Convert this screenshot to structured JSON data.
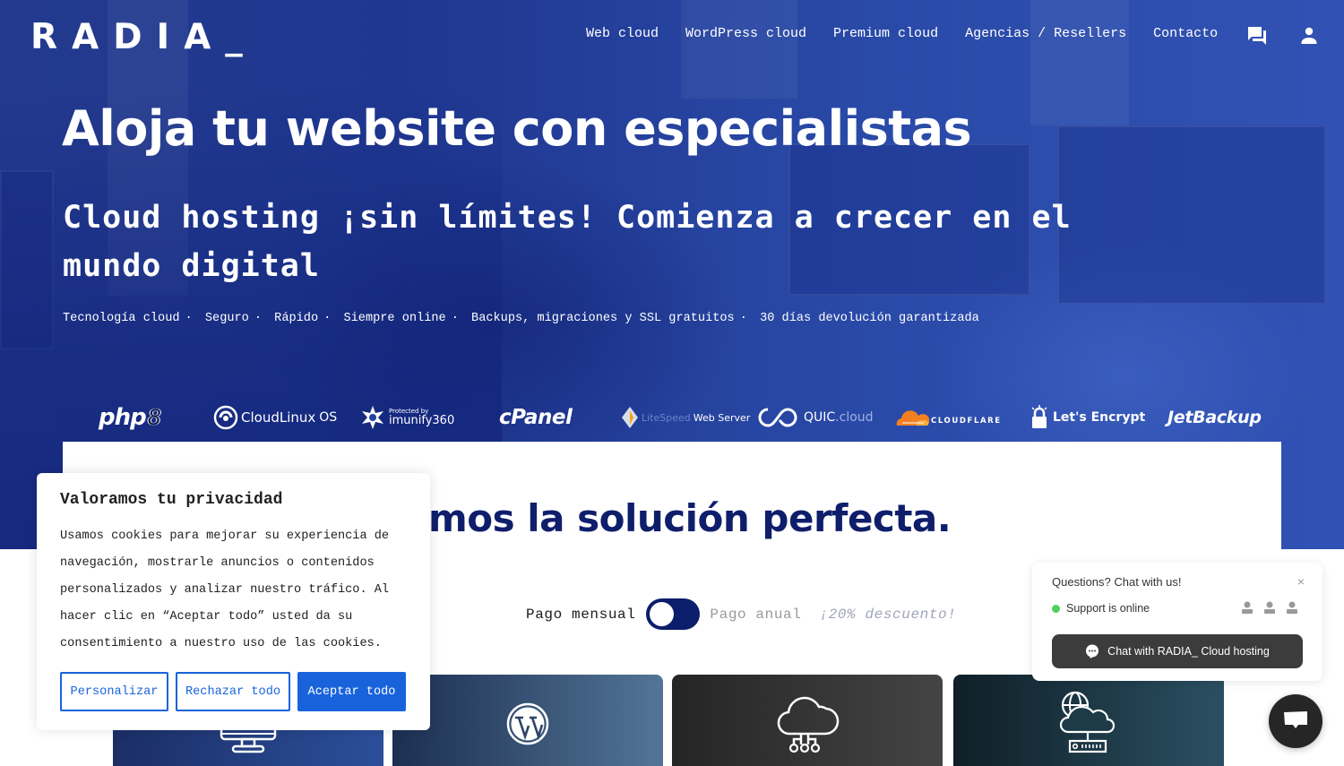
{
  "brand": {
    "logo": "RADIA_"
  },
  "nav": {
    "items": [
      {
        "label": "Web cloud"
      },
      {
        "label": "WordPress cloud"
      },
      {
        "label": "Premium cloud"
      },
      {
        "label": "Agencias / Resellers"
      },
      {
        "label": "Contacto"
      }
    ],
    "icons": [
      "chat-icon",
      "user-icon"
    ]
  },
  "hero": {
    "title": "Aloja tu website con especialistas",
    "subtitle": "Cloud hosting ¡sin límites! Comienza a crecer en el mundo digital",
    "features": [
      "Tecnología cloud",
      "Seguro",
      "Rápido",
      "Siempre online",
      "Backups, migraciones y SSL gratuitos",
      "30 días devolución garantizada"
    ],
    "separator": "·"
  },
  "tech_logos": [
    {
      "name": "php",
      "label": "php",
      "suffix": "8"
    },
    {
      "name": "cloudlinux",
      "label": "CloudLinux",
      "suffix": "OS"
    },
    {
      "name": "imunify360",
      "label": "imunify360",
      "prefix": "Protected by"
    },
    {
      "name": "cpanel",
      "label": "cPanel"
    },
    {
      "name": "litespeed",
      "label": "LiteSpeed",
      "suffix": "Web Server"
    },
    {
      "name": "quic-cloud",
      "label": "QUIC",
      "suffix": ".cloud"
    },
    {
      "name": "cloudflare",
      "label": "CLOUDFLARE"
    },
    {
      "name": "lets-encrypt",
      "label": "Let's Encrypt"
    },
    {
      "name": "jetbackup",
      "label": "JetBackup"
    }
  ],
  "plans": {
    "title_visible": "emos la solución perfecta.",
    "billing": {
      "monthly_label": "Pago mensual",
      "yearly_label": "Pago anual",
      "discount_label": "¡20% descuento!",
      "selected": "monthly"
    },
    "cards": [
      {
        "icon": "monitor-icon",
        "color_from": "#1b2e66",
        "color_to": "#2b4f9a"
      },
      {
        "icon": "wordpress-icon",
        "color_from": "#1c2f52",
        "color_to": "#527596"
      },
      {
        "icon": "cloud-network-icon",
        "color_from": "#252525",
        "color_to": "#444446"
      },
      {
        "icon": "cloud-server-icon",
        "color_from": "#0f1f27",
        "color_to": "#2b5063"
      }
    ]
  },
  "cookie_banner": {
    "title": "Valoramos tu privacidad",
    "body": "Usamos cookies para mejorar su experiencia de navegación, mostrarle anuncios o contenidos personalizados y analizar nuestro tráfico. Al hacer clic en “Aceptar todo” usted da su consentimiento a nuestro uso de las cookies.",
    "buttons": {
      "customize": "Personalizar",
      "reject": "Rechazar todo",
      "accept": "Aceptar todo"
    },
    "accent": "#1863dc"
  },
  "chat_widget": {
    "heading": "Questions? Chat with us!",
    "status": "Support is online",
    "cta": "Chat with RADIA_ Cloud hosting",
    "close": "×",
    "status_color": "#4cd15f"
  },
  "colors": {
    "hero_blue": "#2443a0",
    "navy": "#0f1e6b",
    "toggle": "#0b1e6b"
  }
}
